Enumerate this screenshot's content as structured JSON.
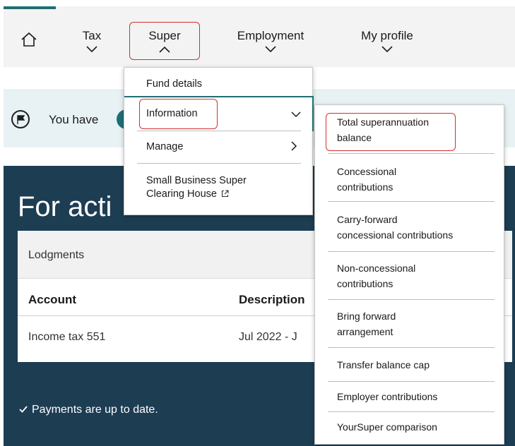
{
  "nav": {
    "tax": "Tax",
    "super": "Super",
    "employment": "Employment",
    "profile": "My profile"
  },
  "notice": {
    "text": "You have"
  },
  "main": {
    "title": "For acti",
    "card_header": "Lodgments",
    "columns": [
      "Account",
      "Description"
    ],
    "rows": [
      {
        "account": "Income tax 551",
        "description": "Jul 2022 - J"
      }
    ],
    "payments_status": "Payments are up to date."
  },
  "super_menu": {
    "items": [
      "Fund details",
      "Information",
      "Manage",
      "Small Business Super",
      "Clearing House"
    ]
  },
  "info_menu": {
    "items": [
      [
        "Total superannuation",
        "balance"
      ],
      [
        "Concessional",
        "contributions"
      ],
      [
        "Carry-forward",
        "concessional contributions"
      ],
      [
        "Non-concessional",
        "contributions"
      ],
      [
        "Bring forward",
        "arrangement"
      ],
      [
        "Transfer balance cap"
      ],
      [
        "Employer contributions"
      ],
      [
        "YourSuper comparison"
      ]
    ]
  },
  "colors": {
    "accent": "#1f6f74",
    "highlight": "#d32f2f",
    "dark_bg": "#1d3d53"
  }
}
